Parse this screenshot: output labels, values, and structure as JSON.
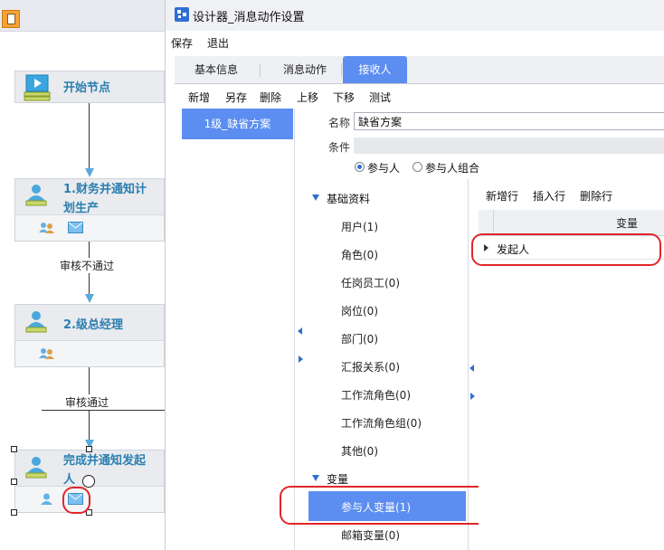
{
  "canvas": {
    "nodes": [
      {
        "title": "开始节点"
      },
      {
        "title": "1.财务并通知计划生产"
      },
      {
        "title": "2.级总经理"
      },
      {
        "title": "完成并通知发起人"
      }
    ],
    "edges": [
      {
        "label": "审核不通过"
      },
      {
        "label": "审核通过"
      }
    ]
  },
  "dialog": {
    "title": "设计器_消息动作设置",
    "menu": [
      "保存",
      "退出"
    ],
    "tabs": [
      "基本信息",
      "消息动作",
      "接收人"
    ],
    "active_tab": "接收人",
    "toolbar": [
      "新增",
      "另存",
      "删除",
      "上移",
      "下移",
      "测试"
    ],
    "scheme_list": [
      "1级_缺省方案"
    ],
    "form": {
      "name_label": "名称",
      "name_value": "缺省方案",
      "condition_label": "条件",
      "radio_participant": "参与人",
      "radio_group": "参与人组合",
      "selected_radio": "参与人"
    },
    "tree": {
      "group1": "基础资料",
      "group1_items": [
        "用户(1)",
        "角色(0)",
        "任岗员工(0)",
        "岗位(0)",
        "部门(0)",
        "汇报关系(0)",
        "工作流角色(0)",
        "工作流角色组(0)",
        "其他(0)"
      ],
      "group2": "变量",
      "group2_items": [
        "参与人变量(1)",
        "邮箱变量(0)"
      ],
      "selected": "参与人变量(1)"
    },
    "grid": {
      "toolbar": [
        "新增行",
        "插入行",
        "删除行"
      ],
      "column": "变量",
      "rows": [
        "发起人"
      ]
    }
  },
  "colors": {
    "accent": "#5b8ef0",
    "highlight": "#e0262b",
    "node_title": "#2b7fb0"
  }
}
